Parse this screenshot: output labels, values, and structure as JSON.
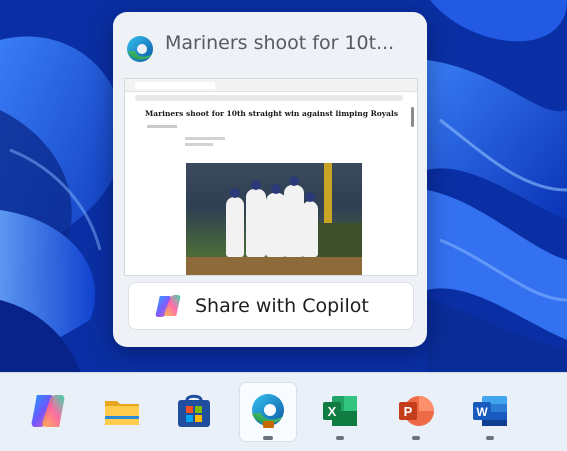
{
  "popup": {
    "app_icon": "edge-icon",
    "title": "Mariners shoot for 10t...",
    "thumbnail": {
      "headline": "Mariners shoot for 10th straight win against limping Royals"
    },
    "share_button": {
      "icon": "copilot-icon",
      "label": "Share with Copilot"
    }
  },
  "taskbar": {
    "items": [
      {
        "name": "copilot",
        "icon": "copilot-icon",
        "running": false,
        "active": false
      },
      {
        "name": "file-explorer",
        "icon": "folder-icon",
        "running": false,
        "active": false
      },
      {
        "name": "microsoft-store",
        "icon": "store-icon",
        "running": false,
        "active": false
      },
      {
        "name": "edge",
        "icon": "edge-icon",
        "running": true,
        "active": true
      },
      {
        "name": "excel",
        "icon": "excel-icon",
        "running": true,
        "active": false
      },
      {
        "name": "powerpoint",
        "icon": "powerpoint-icon",
        "running": true,
        "active": false
      },
      {
        "name": "word",
        "icon": "word-icon",
        "running": true,
        "active": false
      }
    ]
  },
  "colors": {
    "wallpaper_primary": "#0a3ad0",
    "popup_bg": "#eef1f5",
    "taskbar_bg": "#eaf0f7",
    "excel_green": "#107c41",
    "powerpoint_orange": "#d24726",
    "word_blue": "#185abd"
  }
}
